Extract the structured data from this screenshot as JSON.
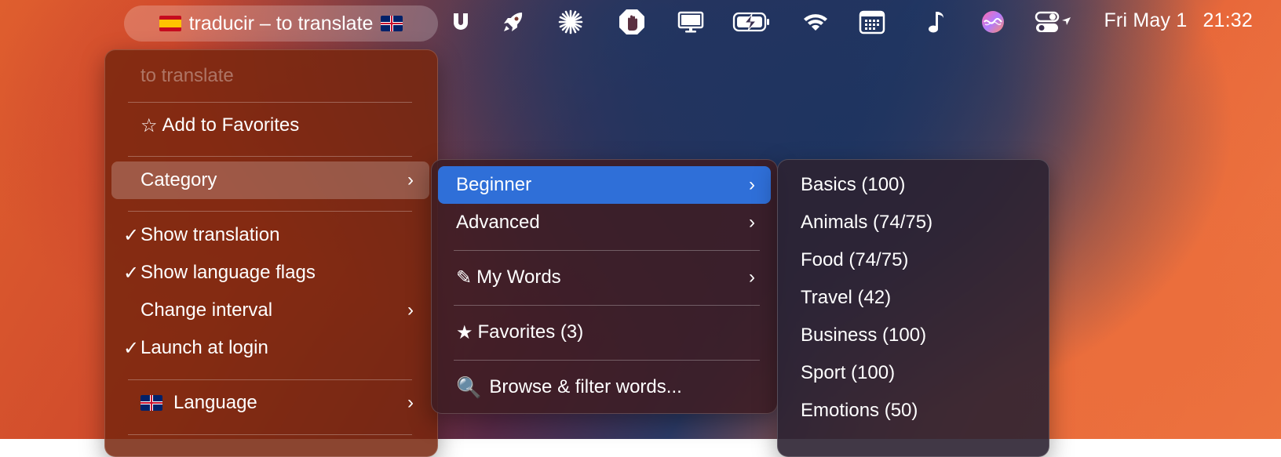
{
  "menubar": {
    "app_title": "traducir – to translate",
    "clock_day": "Fri May 1",
    "clock_time": "21:32",
    "icons": [
      "u-icon",
      "rocket-icon",
      "sparkle-icon",
      "hand-stop-icon",
      "display-icon",
      "battery-charging-icon",
      "wifi-icon",
      "calendar-icon",
      "music-note-icon",
      "siri-icon",
      "control-center-icon"
    ]
  },
  "main_menu": {
    "header": "to translate",
    "add_favorites": "Add to Favorites",
    "category": "Category",
    "show_translation": "Show translation",
    "show_flags": "Show language flags",
    "change_interval": "Change interval",
    "launch_login": "Launch at login",
    "language": "Language",
    "check_mark": "✓",
    "star_outline": "☆",
    "chevron": "›"
  },
  "category_menu": {
    "beginner": "Beginner",
    "advanced": "Advanced",
    "my_words": "My Words",
    "favorites": "Favorites (3)",
    "browse": "Browse & filter words...",
    "pencil": "✎",
    "star_filled": "★",
    "magnifier": "🔍"
  },
  "beginner_menu": {
    "items": [
      "Basics (100)",
      "Animals (74/75)",
      "Food (74/75)",
      "Travel (42)",
      "Business (100)",
      "Sport (100)",
      "Emotions (50)"
    ]
  },
  "colors": {
    "highlight_blue": "#2f6fd8",
    "main_menu_bg": "#78260e"
  }
}
